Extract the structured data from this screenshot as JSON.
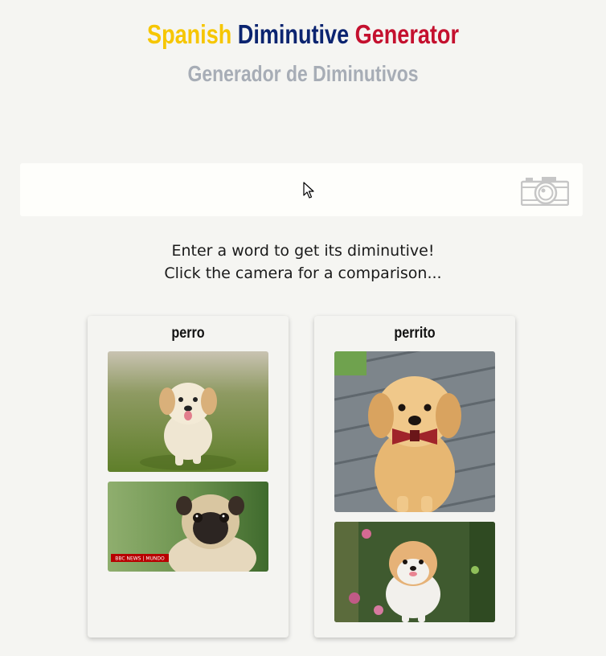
{
  "header": {
    "title_word1": "Spanish",
    "title_word2": "Diminutive",
    "title_word3": "Generator",
    "title_colors": [
      "#f6c600",
      "#0b2470",
      "#c4102e"
    ],
    "subtitle": "Generador de Diminutivos"
  },
  "search": {
    "value": "",
    "placeholder": "",
    "camera_icon": "camera-icon"
  },
  "instructions": {
    "line1": "Enter a word to get its diminutive!",
    "line2": "Click the camera for a comparison..."
  },
  "cards": [
    {
      "word": "perro",
      "images": [
        {
          "subject": "golden retriever puppy running on grass"
        },
        {
          "subject": "pug",
          "caption_logo": "BBC NEWS | MUNDO"
        }
      ]
    },
    {
      "word": "perrito",
      "images": [
        {
          "subject": "golden puppy with plaid bow tie on deck"
        },
        {
          "subject": "fluffy pomeranian puppy among flowers"
        }
      ]
    }
  ]
}
